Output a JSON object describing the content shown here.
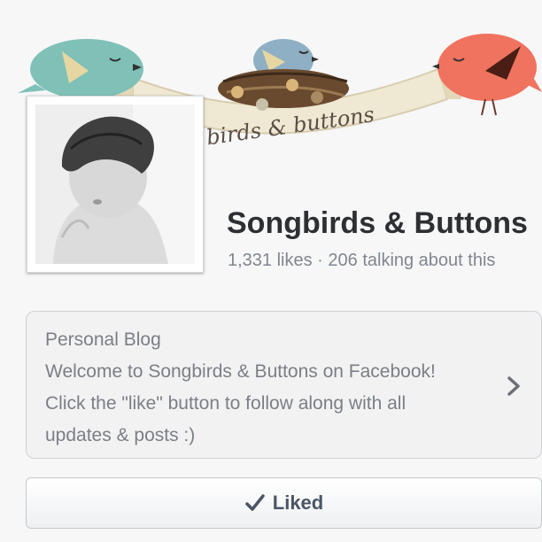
{
  "cover": {
    "banner_text": "birds & buttons",
    "colors": {
      "teal_bird": "#7fc1b7",
      "blue_bird": "#8fb0c4",
      "coral_bird": "#f0735f",
      "banner": "#efe8d2",
      "nest": "#6a4a2f"
    }
  },
  "profile": {
    "name": "Songbirds & Buttons",
    "stats": "1,331 likes · 206 talking about this"
  },
  "about": {
    "category": "Personal Blog",
    "line1": "Welcome to Songbirds & Buttons on Facebook!",
    "line2": "Click the \"like\" button to follow along with all",
    "line3": "updates & posts :)",
    "chevron_icon": "chevron-right-icon"
  },
  "actions": {
    "liked_label": "Liked",
    "check_icon": "checkmark-icon"
  }
}
